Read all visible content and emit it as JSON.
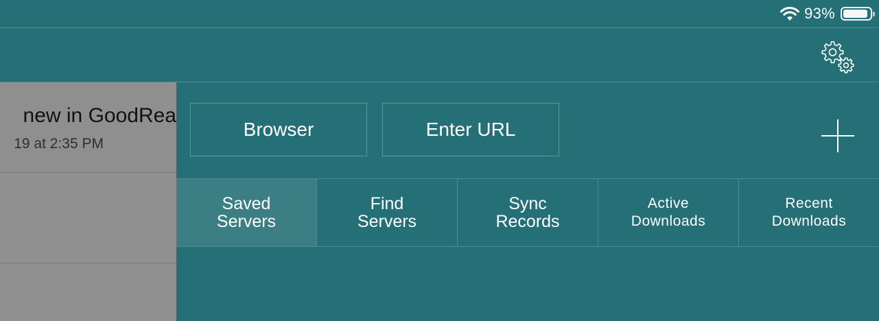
{
  "status_bar": {
    "battery_percent": "93%",
    "battery_level": 0.93,
    "icons": [
      "wifi-icon",
      "battery-icon"
    ]
  },
  "nav_bar": {
    "settings_icon": "gears-icon"
  },
  "document_list": {
    "items": [
      {
        "title": "new in GoodRea",
        "date": "19 at 2:35 PM"
      }
    ]
  },
  "connect": {
    "browser_label": "Browser",
    "enter_url_label": "Enter URL",
    "add_icon": "plus-icon"
  },
  "tabs": [
    {
      "line1": "Saved",
      "line2": "Servers",
      "active": true
    },
    {
      "line1": "Find",
      "line2": "Servers",
      "active": false
    },
    {
      "line1": "Sync",
      "line2": "Records",
      "active": false
    },
    {
      "line1": "Active",
      "line2": "Downloads",
      "active": false
    },
    {
      "line1": "Recent",
      "line2": "Downloads",
      "active": false
    }
  ],
  "colors": {
    "background": "#257076",
    "active_tab": "#3b7f84",
    "left_pane": "#8f8f8f",
    "border": "#4a8e93"
  }
}
